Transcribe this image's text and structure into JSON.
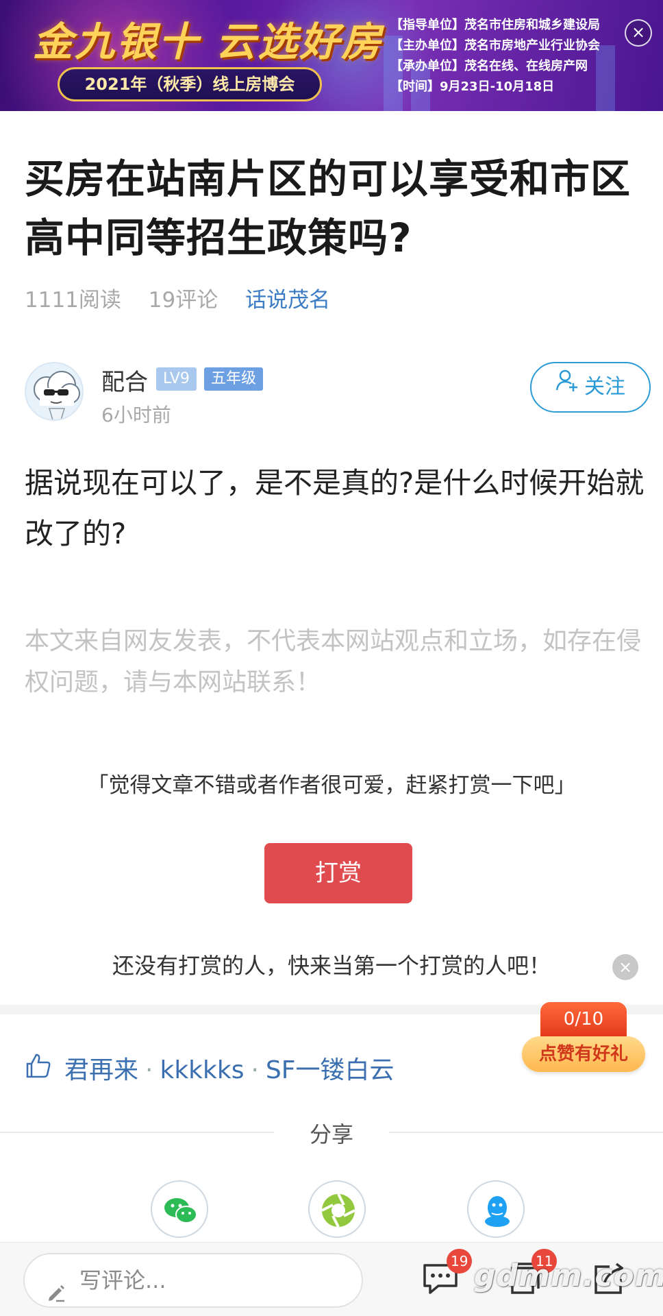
{
  "banner": {
    "title": "金九银十 云选好房",
    "subtitle": "2021年（秋季）线上房博会",
    "info": [
      "【指导单位】茂名市住房和城乡建设局",
      "【主办单位】茂名市房地产业行业协会",
      "【承办单位】茂名在线、在线房产网",
      "【时间】9月23日-10月18日"
    ],
    "close_icon": "×"
  },
  "article": {
    "title": "买房在站南片区的可以享受和市区高中同等招生政策吗?",
    "reads": "1111阅读",
    "comments": "19评论",
    "category": "话说茂名"
  },
  "author": {
    "name": "配合",
    "level": "LV9",
    "grade": "五年级",
    "time": "6小时前",
    "follow_label": "关注"
  },
  "content": {
    "body": "据说现在可以了，是不是真的?是什么时候开始就改了的?",
    "disclaimer": "本文来自网友发表，不代表本网站观点和立场，如存在侵权问题，请与本网站联系！"
  },
  "tip": {
    "prompt": "「觉得文章不错或者作者很可爱，赶紧打赏一下吧」",
    "button_label": "打赏",
    "empty_text": "还没有打赏的人，快来当第一个打赏的人吧！",
    "close_icon": "×"
  },
  "likes": {
    "users": [
      "君再来",
      "kkkkks",
      "SF一镂白云"
    ],
    "separator": "·",
    "reward_count": "0/10",
    "reward_label": "点赞有好礼"
  },
  "share": {
    "title": "分享",
    "targets": [
      "wechat",
      "moments",
      "qq"
    ]
  },
  "bottom_bar": {
    "comment_placeholder": "写评论...",
    "comment_count": "19",
    "second_badge": "11",
    "watermark": "gdmm.com"
  },
  "colors": {
    "accent_blue": "#2a9bd6",
    "link_blue": "#3b6fb0",
    "tip_red": "#e04b4f",
    "badge_red": "#e8483c",
    "wechat_green": "#2dbb55",
    "qq_blue": "#1ea1f2"
  }
}
